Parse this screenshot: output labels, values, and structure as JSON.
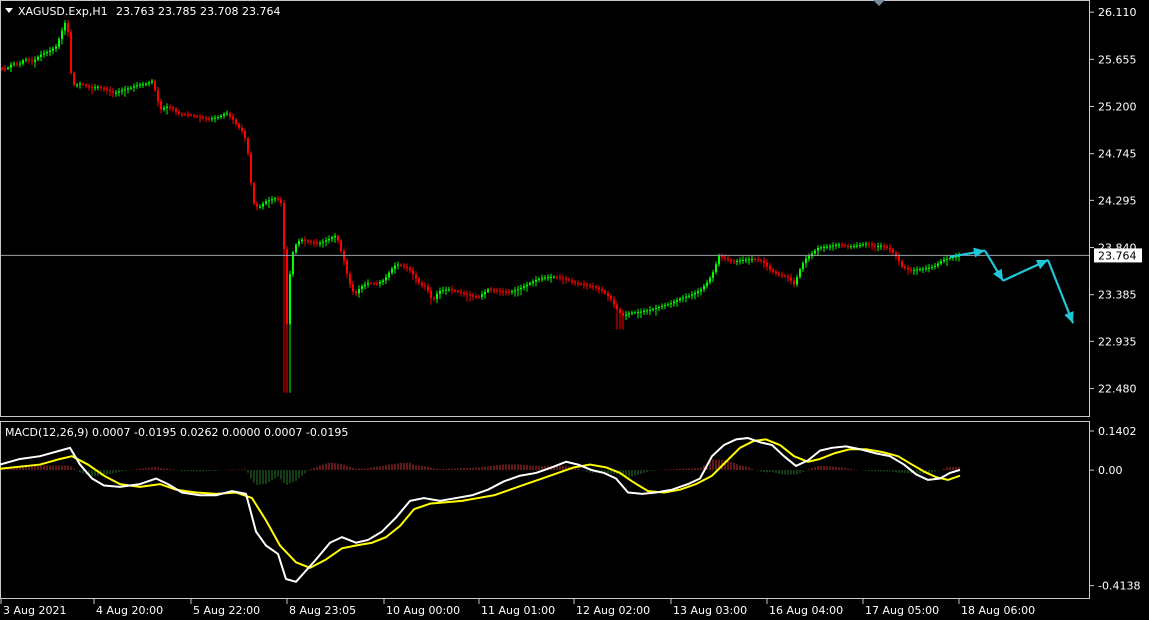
{
  "header": {
    "symbol_label": "XAGUSD.Exp,H1",
    "ohlc_label": "23.763 23.785 23.708 23.764"
  },
  "macd_header": {
    "label": "MACD(12,26,9) 0.0007 -0.0195 0.0262 0.0000 0.0007 -0.0195"
  },
  "colors": {
    "background": "#000000",
    "frame": "#c8c8c8",
    "bull": "#00ff00",
    "bear": "#ff0000",
    "macd_line": "#ffffff",
    "signal_line": "#ffff00",
    "hist_pos": "#c03030",
    "hist_neg": "#2a7a2a",
    "arrow": "#1fc8d8",
    "price_line": "#9aa0a8"
  },
  "chart_data": [
    {
      "type": "candlestick",
      "title": "XAGUSD.Exp,H1",
      "y_ticks": [
        26.11,
        25.655,
        25.2,
        24.745,
        24.295,
        23.84,
        23.385,
        22.935,
        22.48
      ],
      "y_tick_labels": [
        "26.110",
        "25.655",
        "25.200",
        "24.745",
        "24.295",
        "23.840",
        "23.385",
        "22.935",
        "22.480"
      ],
      "ylim": [
        22.36,
        26.15
      ],
      "current_price": 23.764,
      "current_price_label": "23.764",
      "x_labels": [
        "3 Aug 2021",
        "4 Aug 20:00",
        "5 Aug 22:00",
        "8 Aug 23:05",
        "10 Aug 00:00",
        "11 Aug 01:00",
        "12 Aug 02:00",
        "13 Aug 03:00",
        "16 Aug 04:00",
        "17 Aug 05:00",
        "18 Aug 06:00"
      ],
      "path": [
        [
          0,
          25.57
        ],
        [
          8,
          25.56
        ],
        [
          14,
          25.62
        ],
        [
          20,
          25.6
        ],
        [
          26,
          25.66
        ],
        [
          34,
          25.63
        ],
        [
          42,
          25.7
        ],
        [
          50,
          25.73
        ],
        [
          58,
          25.78
        ],
        [
          63,
          25.92
        ],
        [
          67,
          26.02
        ],
        [
          70,
          25.9
        ],
        [
          73,
          25.45
        ],
        [
          76,
          25.4
        ],
        [
          82,
          25.42
        ],
        [
          92,
          25.38
        ],
        [
          100,
          25.39
        ],
        [
          108,
          25.36
        ],
        [
          116,
          25.33
        ],
        [
          124,
          25.36
        ],
        [
          132,
          25.38
        ],
        [
          140,
          25.41
        ],
        [
          148,
          25.42
        ],
        [
          154,
          25.45
        ],
        [
          158,
          25.3
        ],
        [
          162,
          25.17
        ],
        [
          168,
          25.2
        ],
        [
          174,
          25.18
        ],
        [
          180,
          25.13
        ],
        [
          190,
          25.12
        ],
        [
          200,
          25.1
        ],
        [
          210,
          25.08
        ],
        [
          220,
          25.1
        ],
        [
          228,
          25.14
        ],
        [
          234,
          25.08
        ],
        [
          240,
          25.0
        ],
        [
          245,
          24.95
        ],
        [
          249,
          24.8
        ],
        [
          252,
          24.5
        ],
        [
          255,
          24.27
        ],
        [
          260,
          24.22
        ],
        [
          266,
          24.28
        ],
        [
          272,
          24.3
        ],
        [
          278,
          24.32
        ],
        [
          284,
          24.25
        ],
        [
          287,
          23.4
        ],
        [
          289,
          23.0
        ],
        [
          292,
          23.7
        ],
        [
          296,
          23.85
        ],
        [
          302,
          23.92
        ],
        [
          310,
          23.9
        ],
        [
          320,
          23.88
        ],
        [
          330,
          23.92
        ],
        [
          338,
          23.96
        ],
        [
          342,
          23.82
        ],
        [
          346,
          23.7
        ],
        [
          350,
          23.52
        ],
        [
          356,
          23.38
        ],
        [
          362,
          23.46
        ],
        [
          370,
          23.5
        ],
        [
          378,
          23.49
        ],
        [
          386,
          23.53
        ],
        [
          392,
          23.62
        ],
        [
          398,
          23.68
        ],
        [
          404,
          23.66
        ],
        [
          410,
          23.64
        ],
        [
          416,
          23.56
        ],
        [
          422,
          23.48
        ],
        [
          428,
          23.46
        ],
        [
          434,
          23.32
        ],
        [
          440,
          23.42
        ],
        [
          450,
          23.44
        ],
        [
          460,
          23.41
        ],
        [
          470,
          23.38
        ],
        [
          480,
          23.36
        ],
        [
          490,
          23.44
        ],
        [
          500,
          23.42
        ],
        [
          510,
          23.41
        ],
        [
          520,
          23.44
        ],
        [
          530,
          23.49
        ],
        [
          538,
          23.53
        ],
        [
          546,
          23.55
        ],
        [
          556,
          23.56
        ],
        [
          566,
          23.54
        ],
        [
          576,
          23.5
        ],
        [
          586,
          23.48
        ],
        [
          596,
          23.46
        ],
        [
          604,
          23.42
        ],
        [
          612,
          23.35
        ],
        [
          618,
          23.25
        ],
        [
          624,
          23.18
        ],
        [
          632,
          23.21
        ],
        [
          642,
          23.22
        ],
        [
          652,
          23.24
        ],
        [
          662,
          23.27
        ],
        [
          672,
          23.3
        ],
        [
          682,
          23.35
        ],
        [
          692,
          23.38
        ],
        [
          702,
          23.43
        ],
        [
          710,
          23.52
        ],
        [
          716,
          23.63
        ],
        [
          720,
          23.76
        ],
        [
          726,
          23.74
        ],
        [
          734,
          23.7
        ],
        [
          744,
          23.72
        ],
        [
          754,
          23.73
        ],
        [
          764,
          23.71
        ],
        [
          772,
          23.62
        ],
        [
          780,
          23.58
        ],
        [
          790,
          23.55
        ],
        [
          796,
          23.48
        ],
        [
          800,
          23.6
        ],
        [
          806,
          23.72
        ],
        [
          812,
          23.77
        ],
        [
          820,
          23.84
        ],
        [
          830,
          23.85
        ],
        [
          840,
          23.87
        ],
        [
          850,
          23.85
        ],
        [
          860,
          23.86
        ],
        [
          868,
          23.88
        ],
        [
          876,
          23.85
        ],
        [
          884,
          23.86
        ],
        [
          892,
          23.82
        ],
        [
          898,
          23.75
        ],
        [
          904,
          23.65
        ],
        [
          912,
          23.62
        ],
        [
          920,
          23.63
        ],
        [
          928,
          23.64
        ],
        [
          936,
          23.66
        ],
        [
          944,
          23.72
        ],
        [
          952,
          23.74
        ],
        [
          960,
          23.76
        ]
      ],
      "forecast_arrows": [
        {
          "from": [
            950,
            23.75
          ],
          "to": [
            985,
            23.81
          ]
        },
        {
          "from": [
            985,
            23.81
          ],
          "to": [
            1003,
            23.52
          ]
        },
        {
          "from": [
            1003,
            23.52
          ],
          "to": [
            1048,
            23.72
          ]
        },
        {
          "from": [
            1048,
            23.72
          ],
          "to": [
            1073,
            23.11
          ]
        }
      ]
    },
    {
      "type": "line",
      "title": "MACD(12,26,9)",
      "y_ticks": [
        0.1402,
        0.0,
        -0.4138
      ],
      "y_tick_labels": [
        "0.1402",
        "0.00",
        "-0.4138"
      ],
      "ylim": [
        -0.4365,
        0.1402
      ],
      "series": [
        {
          "name": "macd",
          "points": [
            [
              0,
              0.02
            ],
            [
              20,
              0.04
            ],
            [
              40,
              0.05
            ],
            [
              60,
              0.07
            ],
            [
              70,
              0.08
            ],
            [
              80,
              0.02
            ],
            [
              92,
              -0.03
            ],
            [
              104,
              -0.055
            ],
            [
              120,
              -0.06
            ],
            [
              140,
              -0.05
            ],
            [
              156,
              -0.03
            ],
            [
              168,
              -0.05
            ],
            [
              182,
              -0.08
            ],
            [
              200,
              -0.09
            ],
            [
              216,
              -0.09
            ],
            [
              232,
              -0.075
            ],
            [
              246,
              -0.085
            ],
            [
              256,
              -0.22
            ],
            [
              266,
              -0.27
            ],
            [
              278,
              -0.3
            ],
            [
              286,
              -0.39
            ],
            [
              296,
              -0.4
            ],
            [
              306,
              -0.36
            ],
            [
              316,
              -0.32
            ],
            [
              330,
              -0.26
            ],
            [
              342,
              -0.24
            ],
            [
              356,
              -0.26
            ],
            [
              368,
              -0.25
            ],
            [
              382,
              -0.22
            ],
            [
              396,
              -0.17
            ],
            [
              410,
              -0.11
            ],
            [
              424,
              -0.1
            ],
            [
              440,
              -0.11
            ],
            [
              456,
              -0.1
            ],
            [
              472,
              -0.09
            ],
            [
              488,
              -0.07
            ],
            [
              504,
              -0.04
            ],
            [
              520,
              -0.02
            ],
            [
              536,
              -0.01
            ],
            [
              552,
              0.01
            ],
            [
              566,
              0.03
            ],
            [
              578,
              0.02
            ],
            [
              592,
              0.0
            ],
            [
              604,
              -0.01
            ],
            [
              616,
              -0.03
            ],
            [
              628,
              -0.08
            ],
            [
              642,
              -0.085
            ],
            [
              656,
              -0.08
            ],
            [
              672,
              -0.07
            ],
            [
              688,
              -0.05
            ],
            [
              700,
              -0.03
            ],
            [
              712,
              0.05
            ],
            [
              724,
              0.09
            ],
            [
              736,
              0.11
            ],
            [
              748,
              0.115
            ],
            [
              760,
              0.1
            ],
            [
              772,
              0.09
            ],
            [
              784,
              0.05
            ],
            [
              796,
              0.015
            ],
            [
              808,
              0.035
            ],
            [
              820,
              0.07
            ],
            [
              832,
              0.08
            ],
            [
              846,
              0.085
            ],
            [
              860,
              0.075
            ],
            [
              876,
              0.06
            ],
            [
              890,
              0.05
            ],
            [
              904,
              0.02
            ],
            [
              916,
              -0.015
            ],
            [
              928,
              -0.035
            ],
            [
              940,
              -0.03
            ],
            [
              950,
              -0.01
            ],
            [
              960,
              0.001
            ]
          ]
        },
        {
          "name": "signal",
          "points": [
            [
              0,
              0.005
            ],
            [
              40,
              0.02
            ],
            [
              60,
              0.04
            ],
            [
              72,
              0.05
            ],
            [
              88,
              0.02
            ],
            [
              104,
              -0.02
            ],
            [
              120,
              -0.05
            ],
            [
              140,
              -0.06
            ],
            [
              160,
              -0.05
            ],
            [
              176,
              -0.07
            ],
            [
              196,
              -0.08
            ],
            [
              216,
              -0.085
            ],
            [
              236,
              -0.08
            ],
            [
              252,
              -0.1
            ],
            [
              266,
              -0.18
            ],
            [
              280,
              -0.27
            ],
            [
              296,
              -0.33
            ],
            [
              310,
              -0.35
            ],
            [
              326,
              -0.32
            ],
            [
              342,
              -0.28
            ],
            [
              356,
              -0.27
            ],
            [
              372,
              -0.26
            ],
            [
              386,
              -0.24
            ],
            [
              400,
              -0.2
            ],
            [
              414,
              -0.14
            ],
            [
              430,
              -0.12
            ],
            [
              446,
              -0.115
            ],
            [
              462,
              -0.11
            ],
            [
              478,
              -0.1
            ],
            [
              494,
              -0.09
            ],
            [
              510,
              -0.07
            ],
            [
              526,
              -0.05
            ],
            [
              542,
              -0.03
            ],
            [
              558,
              -0.01
            ],
            [
              574,
              0.01
            ],
            [
              590,
              0.02
            ],
            [
              606,
              0.01
            ],
            [
              620,
              -0.01
            ],
            [
              632,
              -0.04
            ],
            [
              648,
              -0.075
            ],
            [
              664,
              -0.08
            ],
            [
              680,
              -0.07
            ],
            [
              696,
              -0.05
            ],
            [
              712,
              -0.02
            ],
            [
              726,
              0.03
            ],
            [
              740,
              0.08
            ],
            [
              754,
              0.105
            ],
            [
              766,
              0.11
            ],
            [
              780,
              0.09
            ],
            [
              794,
              0.05
            ],
            [
              808,
              0.03
            ],
            [
              820,
              0.04
            ],
            [
              834,
              0.06
            ],
            [
              850,
              0.075
            ],
            [
              866,
              0.075
            ],
            [
              882,
              0.065
            ],
            [
              898,
              0.05
            ],
            [
              912,
              0.02
            ],
            [
              924,
              -0.005
            ],
            [
              936,
              -0.025
            ],
            [
              948,
              -0.035
            ],
            [
              960,
              -0.02
            ]
          ]
        }
      ]
    }
  ]
}
